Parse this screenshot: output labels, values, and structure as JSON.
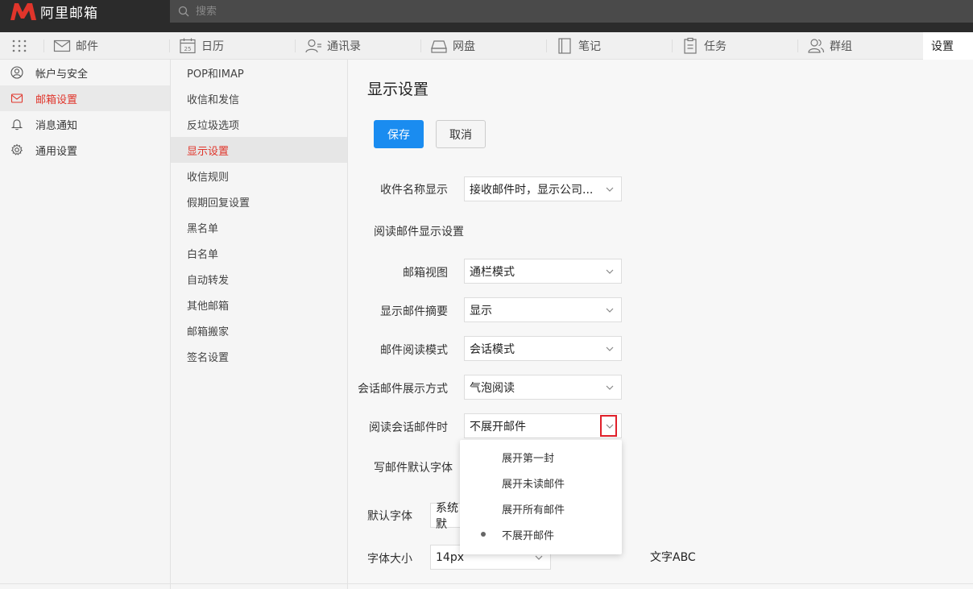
{
  "app": {
    "logo_text": "阿里邮箱"
  },
  "search": {
    "placeholder": "搜索"
  },
  "nav": {
    "items": [
      {
        "label": "邮件",
        "icon": "mail-icon"
      },
      {
        "label": "日历",
        "icon": "calendar-icon",
        "badge": "25"
      },
      {
        "label": "通讯录",
        "icon": "contacts-icon"
      },
      {
        "label": "网盘",
        "icon": "drive-icon"
      },
      {
        "label": "笔记",
        "icon": "notebook-icon"
      },
      {
        "label": "任务",
        "icon": "task-icon"
      },
      {
        "label": "群组",
        "icon": "group-icon"
      }
    ],
    "active": "设置"
  },
  "sidebar": {
    "items": [
      {
        "label": "帐户与安全",
        "icon": "user-icon"
      },
      {
        "label": "邮箱设置",
        "icon": "mail-icon"
      },
      {
        "label": "消息通知",
        "icon": "bell-icon"
      },
      {
        "label": "通用设置",
        "icon": "gear-icon"
      }
    ]
  },
  "submenu": {
    "items": [
      "POP和IMAP",
      "收信和发信",
      "反垃圾选项",
      "显示设置",
      "收信规则",
      "假期回复设置",
      "黑名单",
      "白名单",
      "自动转发",
      "其他邮箱",
      "邮箱搬家",
      "签名设置"
    ]
  },
  "main": {
    "title": "显示设置",
    "save": "保存",
    "cancel": "取消",
    "recipient_name": {
      "label": "收件名称显示",
      "value": "接收邮件时，显示公司..."
    },
    "read_section": "阅读邮件显示设置",
    "mailbox_view": {
      "label": "邮箱视图",
      "value": "通栏模式"
    },
    "show_summary": {
      "label": "显示邮件摘要",
      "value": "显示"
    },
    "read_mode": {
      "label": "邮件阅读模式",
      "value": "会话模式"
    },
    "conversation_display": {
      "label": "会话邮件展示方式",
      "value": "气泡阅读"
    },
    "read_conversation": {
      "label": "阅读会话邮件时",
      "value": "不展开邮件"
    },
    "compose_font_section": "写邮件默认字体",
    "default_font": {
      "label": "默认字体",
      "value": "系统默"
    },
    "font_size": {
      "label": "字体大小",
      "value": "14px"
    },
    "preview_text": "文字ABC"
  },
  "dropdown": {
    "options": [
      "展开第一封",
      "展开未读邮件",
      "展开所有邮件",
      "不展开邮件"
    ],
    "selected": "不展开邮件"
  }
}
